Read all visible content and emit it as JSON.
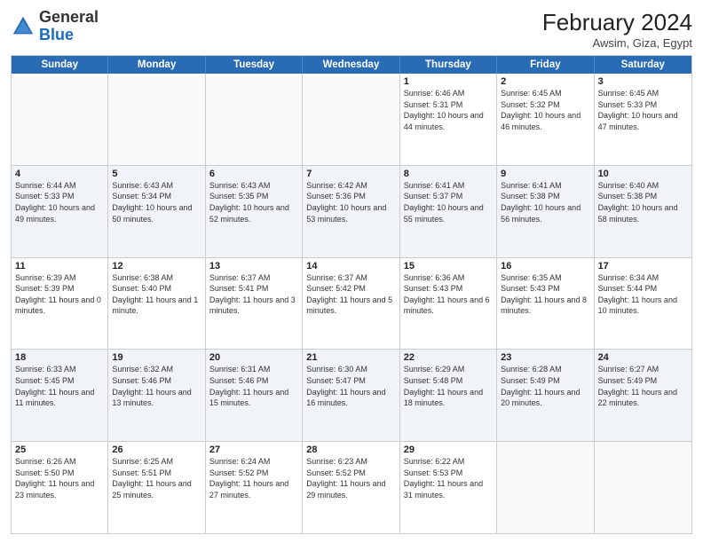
{
  "header": {
    "logo": {
      "general": "General",
      "blue": "Blue"
    },
    "title": "February 2024",
    "location": "Awsim, Giza, Egypt"
  },
  "days_of_week": [
    "Sunday",
    "Monday",
    "Tuesday",
    "Wednesday",
    "Thursday",
    "Friday",
    "Saturday"
  ],
  "weeks": [
    [
      {
        "day": "",
        "sunrise": "",
        "sunset": "",
        "daylight": ""
      },
      {
        "day": "",
        "sunrise": "",
        "sunset": "",
        "daylight": ""
      },
      {
        "day": "",
        "sunrise": "",
        "sunset": "",
        "daylight": ""
      },
      {
        "day": "",
        "sunrise": "",
        "sunset": "",
        "daylight": ""
      },
      {
        "day": "1",
        "sunrise": "Sunrise: 6:46 AM",
        "sunset": "Sunset: 5:31 PM",
        "daylight": "Daylight: 10 hours and 44 minutes."
      },
      {
        "day": "2",
        "sunrise": "Sunrise: 6:45 AM",
        "sunset": "Sunset: 5:32 PM",
        "daylight": "Daylight: 10 hours and 46 minutes."
      },
      {
        "day": "3",
        "sunrise": "Sunrise: 6:45 AM",
        "sunset": "Sunset: 5:33 PM",
        "daylight": "Daylight: 10 hours and 47 minutes."
      }
    ],
    [
      {
        "day": "4",
        "sunrise": "Sunrise: 6:44 AM",
        "sunset": "Sunset: 5:33 PM",
        "daylight": "Daylight: 10 hours and 49 minutes."
      },
      {
        "day": "5",
        "sunrise": "Sunrise: 6:43 AM",
        "sunset": "Sunset: 5:34 PM",
        "daylight": "Daylight: 10 hours and 50 minutes."
      },
      {
        "day": "6",
        "sunrise": "Sunrise: 6:43 AM",
        "sunset": "Sunset: 5:35 PM",
        "daylight": "Daylight: 10 hours and 52 minutes."
      },
      {
        "day": "7",
        "sunrise": "Sunrise: 6:42 AM",
        "sunset": "Sunset: 5:36 PM",
        "daylight": "Daylight: 10 hours and 53 minutes."
      },
      {
        "day": "8",
        "sunrise": "Sunrise: 6:41 AM",
        "sunset": "Sunset: 5:37 PM",
        "daylight": "Daylight: 10 hours and 55 minutes."
      },
      {
        "day": "9",
        "sunrise": "Sunrise: 6:41 AM",
        "sunset": "Sunset: 5:38 PM",
        "daylight": "Daylight: 10 hours and 56 minutes."
      },
      {
        "day": "10",
        "sunrise": "Sunrise: 6:40 AM",
        "sunset": "Sunset: 5:38 PM",
        "daylight": "Daylight: 10 hours and 58 minutes."
      }
    ],
    [
      {
        "day": "11",
        "sunrise": "Sunrise: 6:39 AM",
        "sunset": "Sunset: 5:39 PM",
        "daylight": "Daylight: 11 hours and 0 minutes."
      },
      {
        "day": "12",
        "sunrise": "Sunrise: 6:38 AM",
        "sunset": "Sunset: 5:40 PM",
        "daylight": "Daylight: 11 hours and 1 minute."
      },
      {
        "day": "13",
        "sunrise": "Sunrise: 6:37 AM",
        "sunset": "Sunset: 5:41 PM",
        "daylight": "Daylight: 11 hours and 3 minutes."
      },
      {
        "day": "14",
        "sunrise": "Sunrise: 6:37 AM",
        "sunset": "Sunset: 5:42 PM",
        "daylight": "Daylight: 11 hours and 5 minutes."
      },
      {
        "day": "15",
        "sunrise": "Sunrise: 6:36 AM",
        "sunset": "Sunset: 5:43 PM",
        "daylight": "Daylight: 11 hours and 6 minutes."
      },
      {
        "day": "16",
        "sunrise": "Sunrise: 6:35 AM",
        "sunset": "Sunset: 5:43 PM",
        "daylight": "Daylight: 11 hours and 8 minutes."
      },
      {
        "day": "17",
        "sunrise": "Sunrise: 6:34 AM",
        "sunset": "Sunset: 5:44 PM",
        "daylight": "Daylight: 11 hours and 10 minutes."
      }
    ],
    [
      {
        "day": "18",
        "sunrise": "Sunrise: 6:33 AM",
        "sunset": "Sunset: 5:45 PM",
        "daylight": "Daylight: 11 hours and 11 minutes."
      },
      {
        "day": "19",
        "sunrise": "Sunrise: 6:32 AM",
        "sunset": "Sunset: 5:46 PM",
        "daylight": "Daylight: 11 hours and 13 minutes."
      },
      {
        "day": "20",
        "sunrise": "Sunrise: 6:31 AM",
        "sunset": "Sunset: 5:46 PM",
        "daylight": "Daylight: 11 hours and 15 minutes."
      },
      {
        "day": "21",
        "sunrise": "Sunrise: 6:30 AM",
        "sunset": "Sunset: 5:47 PM",
        "daylight": "Daylight: 11 hours and 16 minutes."
      },
      {
        "day": "22",
        "sunrise": "Sunrise: 6:29 AM",
        "sunset": "Sunset: 5:48 PM",
        "daylight": "Daylight: 11 hours and 18 minutes."
      },
      {
        "day": "23",
        "sunrise": "Sunrise: 6:28 AM",
        "sunset": "Sunset: 5:49 PM",
        "daylight": "Daylight: 11 hours and 20 minutes."
      },
      {
        "day": "24",
        "sunrise": "Sunrise: 6:27 AM",
        "sunset": "Sunset: 5:49 PM",
        "daylight": "Daylight: 11 hours and 22 minutes."
      }
    ],
    [
      {
        "day": "25",
        "sunrise": "Sunrise: 6:26 AM",
        "sunset": "Sunset: 5:50 PM",
        "daylight": "Daylight: 11 hours and 23 minutes."
      },
      {
        "day": "26",
        "sunrise": "Sunrise: 6:25 AM",
        "sunset": "Sunset: 5:51 PM",
        "daylight": "Daylight: 11 hours and 25 minutes."
      },
      {
        "day": "27",
        "sunrise": "Sunrise: 6:24 AM",
        "sunset": "Sunset: 5:52 PM",
        "daylight": "Daylight: 11 hours and 27 minutes."
      },
      {
        "day": "28",
        "sunrise": "Sunrise: 6:23 AM",
        "sunset": "Sunset: 5:52 PM",
        "daylight": "Daylight: 11 hours and 29 minutes."
      },
      {
        "day": "29",
        "sunrise": "Sunrise: 6:22 AM",
        "sunset": "Sunset: 5:53 PM",
        "daylight": "Daylight: 11 hours and 31 minutes."
      },
      {
        "day": "",
        "sunrise": "",
        "sunset": "",
        "daylight": ""
      },
      {
        "day": "",
        "sunrise": "",
        "sunset": "",
        "daylight": ""
      }
    ]
  ]
}
